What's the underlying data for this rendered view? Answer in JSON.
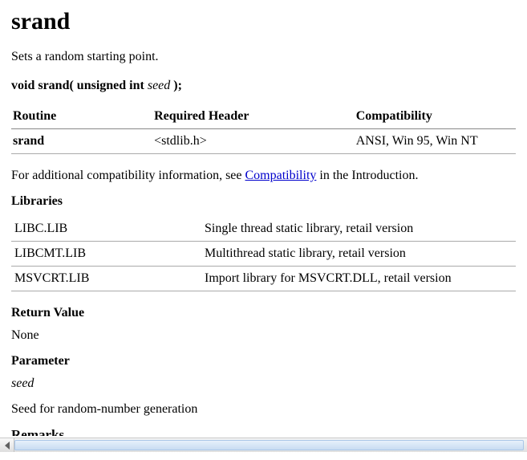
{
  "title": "srand",
  "description": "Sets a random starting point.",
  "signature": {
    "prefix": "void srand( unsigned int ",
    "param": "seed",
    "suffix": " );"
  },
  "routine_table": {
    "headers": [
      "Routine",
      "Required Header",
      "Compatibility"
    ],
    "rows": [
      {
        "routine": "srand",
        "header": "<stdlib.h>",
        "compat": "ANSI, Win 95, Win NT"
      }
    ]
  },
  "compat_note": {
    "before": "For additional compatibility information, see ",
    "link": "Compatibility",
    "after": " in the Introduction."
  },
  "libraries": {
    "heading": "Libraries",
    "rows": [
      {
        "name": "LIBC.LIB",
        "desc": "Single thread static library, retail version"
      },
      {
        "name": "LIBCMT.LIB",
        "desc": "Multithread static library, retail version"
      },
      {
        "name": "MSVCRT.LIB",
        "desc": "Import library for MSVCRT.DLL, retail version"
      }
    ]
  },
  "return_value": {
    "heading": "Return Value",
    "text": "None"
  },
  "parameter": {
    "heading": "Parameter",
    "name": "seed",
    "desc": "Seed for random-number generation"
  },
  "remarks_heading": "Remarks"
}
